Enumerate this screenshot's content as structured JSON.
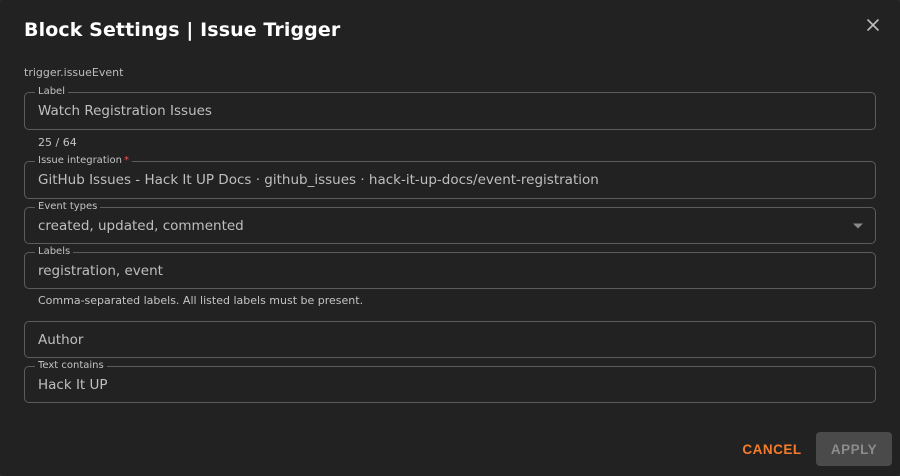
{
  "dialog": {
    "title": "Block Settings | Issue Trigger",
    "block_type": "trigger.issueEvent"
  },
  "fields": {
    "label": {
      "legend": "Label",
      "value": "Watch Registration Issues",
      "counter": "25 / 64"
    },
    "integration": {
      "legend": "Issue integration",
      "required_mark": "*",
      "value": "GitHub Issues - Hack It UP Docs · github_issues · hack-it-up-docs/event-registration"
    },
    "event_types": {
      "legend": "Event types",
      "value": "created, updated, commented"
    },
    "labels": {
      "legend": "Labels",
      "value": "registration, event",
      "helper": "Comma-separated labels. All listed labels must be present."
    },
    "author": {
      "placeholder": "Author"
    },
    "text_contains": {
      "legend": "Text contains",
      "value": "Hack It UP"
    }
  },
  "actions": {
    "cancel_label": "CANCEL",
    "apply_label": "APPLY"
  },
  "colors": {
    "accent": "#f57c2b",
    "required": "#ef5350",
    "background": "#222222",
    "border": "#5c5c5c"
  },
  "icons": {
    "close": "close-icon",
    "dropdown": "chevron-down-icon"
  }
}
